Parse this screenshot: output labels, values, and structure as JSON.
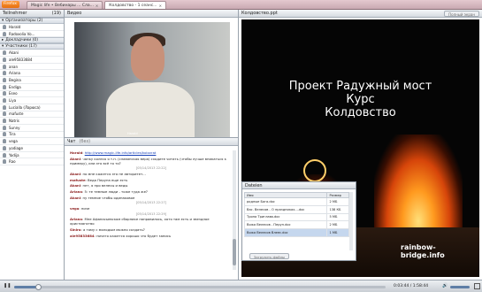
{
  "topbar": {
    "app_button": "Firefox",
    "tabs": [
      {
        "label": "Magic life • Вебинары ... Сла..."
      },
      {
        "label": "Колдовство - 1 сеанс..."
      }
    ]
  },
  "left": {
    "title": "Teilnehmer",
    "count": "(19)",
    "section_org": "Организаторы (2)",
    "organizers": [
      "Harald",
      "Radoxolia Vo..."
    ],
    "section_helpers": "Докладчики (0)",
    "section_participants": "Участники (17)",
    "participants": [
      "Akani",
      "ale95833684",
      "anan",
      "Ariana",
      "Begina",
      "Endiga",
      "Eseo",
      "Liya",
      "Lucialla (Ларюса)",
      "mafuste",
      "Natris",
      "Sunny",
      "Tira",
      "vega",
      "yodiage",
      "Yadija",
      "Rao"
    ]
  },
  "video": {
    "title": "Видео",
    "name_tag": "Harald"
  },
  "chat": {
    "title": "Чат",
    "subtitle": "(без)",
    "messages": [
      {
        "author": "Harald",
        "text": "",
        "link": "http://www.magic-life.info/articles/kolovrat"
      },
      {
        "author": "Akani",
        "text": "чанку колесо я т.п. (славянская вера) сходите читать (чтобы лучше вникаться к примеру), или это всё то то?",
        "link": ""
      },
      {
        "stamp": "[05/14/2013 22:22]"
      },
      {
        "author": "Akani",
        "text": "но мне кажется это не авторитет...",
        "link": ""
      },
      {
        "author": "mafuste",
        "text": "Веда Перуна еще есть",
        "link": ""
      },
      {
        "author": "Akani",
        "text": "нет, я про велесы и веды",
        "link": ""
      },
      {
        "author": "Ariana",
        "text": "5: те темные люди - тоже туда же?",
        "link": ""
      },
      {
        "author": "Akani",
        "text": "ну темное чтобы одинаковое",
        "link": ""
      },
      {
        "stamp": "[05/14/2013 22:27]"
      },
      {
        "author": "vega",
        "text": "ниче",
        "link": ""
      },
      {
        "stamp": "[05/14/2013 22:29]"
      },
      {
        "author": "Ariana",
        "text": "Мне Афанасьевском сборнике понравилось, хотя там есть и звездное христианство",
        "link": ""
      },
      {
        "author": "Sinira",
        "text": "а тому с молодым можно создать?",
        "link": ""
      },
      {
        "author": "ale95833684",
        "text": "ничего кажется хорошо что будет запись",
        "link": ""
      }
    ]
  },
  "presentation": {
    "title": "Колдовство.ppt",
    "open_button": "Полный экран",
    "slide_lines": [
      "Проект Радужный мост",
      "Курс",
      "Колдовство"
    ],
    "watermark": "rainbow-bridge.info"
  },
  "files": {
    "title": "Dateien",
    "col_name": "Имя",
    "col_size": "Размер",
    "rows": [
      {
        "name": "родные Бога.doc",
        "size": "2 МБ"
      },
      {
        "name": "Вас. Велесов - О праздниках....doc",
        "size": "138 КБ"
      },
      {
        "name": "Тропа Триглава.doc",
        "size": "5 МБ"
      },
      {
        "name": "Вожа Велесов - Перун.doc",
        "size": "2 МБ"
      },
      {
        "name": "Вожа Велесов Влеес.doc",
        "size": "1 МБ"
      }
    ],
    "download_button": "Загрузить файлы"
  },
  "player": {
    "play_icon": "pause-icon",
    "progress": 0.065,
    "time": "0:03:44 / 1:58:44",
    "volume": 0.9
  }
}
